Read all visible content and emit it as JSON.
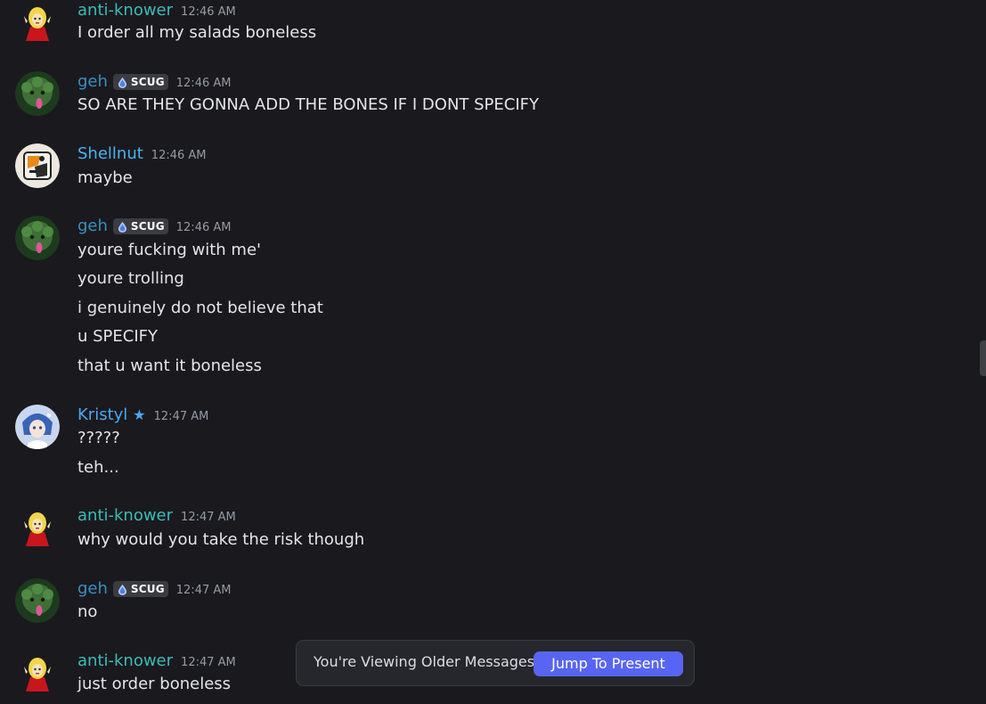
{
  "colors": {
    "background": "#1a1a1e",
    "anti_knower": "#3bbcb8",
    "geh": "#3a8fc2",
    "shellnut": "#4cb1f0",
    "kristyl": "#4aa8f0",
    "accent_button": "#5865f2",
    "message_text": "#e3e5e8",
    "timestamp": "#949ba4"
  },
  "messages": [
    {
      "author": "anti-knower",
      "avatar_icon": "anti-knower-avatar-icon",
      "time": "12:46 AM",
      "lines": [
        "I order all my salads boneless"
      ]
    },
    {
      "author": "geh",
      "tag": "SCUG",
      "tag_icon": "droplet-icon",
      "avatar_icon": "geh-avatar-icon",
      "time": "12:46 AM",
      "lines": [
        "SO ARE THEY GONNA ADD THE BONES IF I DONT SPECIFY"
      ]
    },
    {
      "author": "Shellnut",
      "avatar_icon": "shellnut-avatar-icon",
      "time": "12:46 AM",
      "lines": [
        "maybe"
      ]
    },
    {
      "author": "geh",
      "tag": "SCUG",
      "tag_icon": "droplet-icon",
      "avatar_icon": "geh-avatar-icon",
      "time": "12:46 AM",
      "lines": [
        "youre fucking with me'",
        "youre trolling",
        "i genuinely do not believe that",
        "u SPECIFY",
        "that u want it boneless"
      ]
    },
    {
      "author": "Kristyl",
      "badge_icon": "star-icon",
      "avatar_icon": "kristyl-avatar-icon",
      "time": "12:47 AM",
      "lines": [
        "?????",
        "teh..."
      ]
    },
    {
      "author": "anti-knower",
      "avatar_icon": "anti-knower-avatar-icon",
      "time": "12:47 AM",
      "lines": [
        "why would you take the risk though"
      ]
    },
    {
      "author": "geh",
      "tag": "SCUG",
      "tag_icon": "droplet-icon",
      "avatar_icon": "geh-avatar-icon",
      "time": "12:47 AM",
      "lines": [
        "no"
      ]
    },
    {
      "author": "anti-knower",
      "avatar_icon": "anti-knower-avatar-icon",
      "time": "12:47 AM",
      "lines": [
        "just order boneless"
      ]
    }
  ],
  "older_messages_bar": {
    "label": "You're Viewing Older Messages",
    "button_label": "Jump To Present"
  },
  "star_glyph": "★"
}
